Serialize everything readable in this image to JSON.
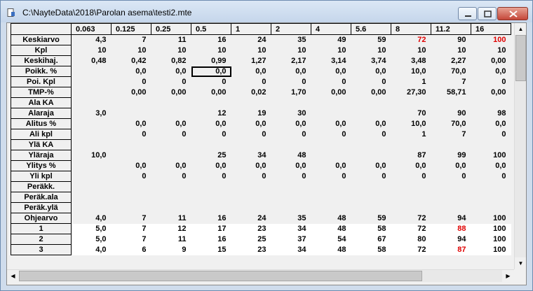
{
  "window": {
    "title": "C:\\NayteData\\2018\\Parolan asema\\testi2.mte"
  },
  "columns": [
    "0.063",
    "0.125",
    "0.25",
    "0.5",
    "1",
    "2",
    "4",
    "5.6",
    "8",
    "11.2",
    "16"
  ],
  "rows": [
    {
      "label": "Keskiarvo",
      "values": [
        "4,3",
        "7",
        "11",
        "16",
        "24",
        "35",
        "49",
        "59",
        "72",
        "90",
        "100"
      ],
      "red": [
        8,
        10
      ]
    },
    {
      "label": "Kpl",
      "values": [
        "10",
        "10",
        "10",
        "10",
        "10",
        "10",
        "10",
        "10",
        "10",
        "10",
        "10"
      ]
    },
    {
      "label": "Keskihaj.",
      "values": [
        "0,48",
        "0,42",
        "0,82",
        "0,99",
        "1,27",
        "2,17",
        "3,14",
        "3,74",
        "3,48",
        "2,27",
        "0,00"
      ]
    },
    {
      "label": "Poikk. %",
      "values": [
        "",
        "0,0",
        "0,0",
        "0,0",
        "0,0",
        "0,0",
        "0,0",
        "0,0",
        "10,0",
        "70,0",
        "0,0"
      ],
      "selected": 3
    },
    {
      "label": "Poi. Kpl",
      "values": [
        "",
        "0",
        "0",
        "0",
        "0",
        "0",
        "0",
        "0",
        "1",
        "7",
        "0"
      ]
    },
    {
      "label": "TMP-%",
      "values": [
        "",
        "0,00",
        "0,00",
        "0,00",
        "0,02",
        "1,70",
        "0,00",
        "0,00",
        "27,30",
        "58,71",
        "0,00"
      ]
    },
    {
      "label": "Ala KA",
      "values": [
        "",
        "",
        "",
        "",
        "",
        "",
        "",
        "",
        "",
        "",
        ""
      ]
    },
    {
      "label": "Alaraja",
      "values": [
        "3,0",
        "",
        "",
        "12",
        "19",
        "30",
        "",
        "",
        "70",
        "90",
        "98"
      ]
    },
    {
      "label": "Alitus %",
      "values": [
        "",
        "0,0",
        "0,0",
        "0,0",
        "0,0",
        "0,0",
        "0,0",
        "0,0",
        "10,0",
        "70,0",
        "0,0"
      ]
    },
    {
      "label": "Ali kpl",
      "values": [
        "",
        "0",
        "0",
        "0",
        "0",
        "0",
        "0",
        "0",
        "1",
        "7",
        "0"
      ]
    },
    {
      "label": "Ylä KA",
      "values": [
        "",
        "",
        "",
        "",
        "",
        "",
        "",
        "",
        "",
        "",
        ""
      ]
    },
    {
      "label": "Yläraja",
      "values": [
        "10,0",
        "",
        "",
        "25",
        "34",
        "48",
        "",
        "",
        "87",
        "99",
        "100"
      ]
    },
    {
      "label": "Ylitys %",
      "values": [
        "",
        "0,0",
        "0,0",
        "0,0",
        "0,0",
        "0,0",
        "0,0",
        "0,0",
        "0,0",
        "0,0",
        "0,0"
      ]
    },
    {
      "label": "Yli kpl",
      "values": [
        "",
        "0",
        "0",
        "0",
        "0",
        "0",
        "0",
        "0",
        "0",
        "0",
        "0"
      ]
    },
    {
      "label": "Peräkk.",
      "values": [
        "",
        "",
        "",
        "",
        "",
        "",
        "",
        "",
        "",
        "",
        ""
      ]
    },
    {
      "label": "Peräk.ala",
      "values": [
        "",
        "",
        "",
        "",
        "",
        "",
        "",
        "",
        "",
        "",
        ""
      ]
    },
    {
      "label": "Peräk.ylä",
      "values": [
        "",
        "",
        "",
        "",
        "",
        "",
        "",
        "",
        "",
        "",
        ""
      ]
    },
    {
      "label": "Ohjearvo",
      "values": [
        "4,0",
        "7",
        "11",
        "16",
        "24",
        "35",
        "48",
        "59",
        "72",
        "94",
        "100"
      ]
    },
    {
      "label": "1",
      "values": [
        "5,0",
        "7",
        "12",
        "17",
        "23",
        "34",
        "48",
        "58",
        "72",
        "88",
        "100"
      ],
      "red": [
        9
      ],
      "bright": true
    },
    {
      "label": "2",
      "values": [
        "5,0",
        "7",
        "11",
        "16",
        "25",
        "37",
        "54",
        "67",
        "80",
        "94",
        "100"
      ],
      "bright": true
    },
    {
      "label": "3",
      "values": [
        "4,0",
        "6",
        "9",
        "15",
        "23",
        "34",
        "48",
        "58",
        "72",
        "87",
        "100"
      ],
      "red": [
        9
      ],
      "bright": true
    }
  ],
  "colors": {
    "accent_red": "#e00000",
    "title_bg": "#cfdcec",
    "grid_bg": "#f0f0f0"
  }
}
